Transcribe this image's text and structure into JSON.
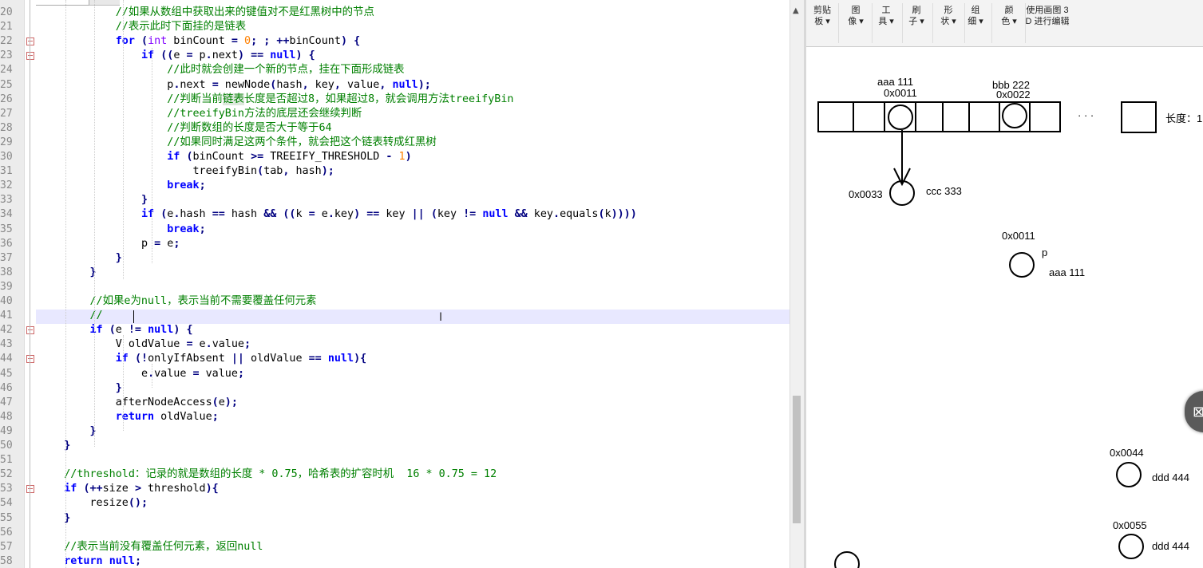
{
  "editor": {
    "lines": [
      {
        "n": "20",
        "html": "            <span class='cm'>//如果从数组中获取出来的键值对不是红黑树中的节点</span>"
      },
      {
        "n": "21",
        "html": "            <span class='cm'>//表示此时下面挂的是链表</span>"
      },
      {
        "n": "22",
        "html": "            <span class='kw'>for</span> <span class='op'>(</span><span class='typ'>int</span> binCount <span class='op'>=</span> <span class='num'>0</span><span class='op'>;</span> <span class='op'>;</span> <span class='op'>++</span>binCount<span class='op'>)</span> <span class='op'>{</span>"
      },
      {
        "n": "23",
        "html": "                <span class='kw'>if</span> <span class='op'>((</span>e <span class='op'>=</span> p<span class='op'>.</span>next<span class='op'>)</span> <span class='op'>==</span> <span class='kw'>null</span><span class='op'>)</span> <span class='op'>{</span>"
      },
      {
        "n": "24",
        "html": "                    <span class='cm'>//此时就会创建一个新的节点，挂在下面形成链表</span>"
      },
      {
        "n": "25",
        "html": "                    p<span class='op'>.</span>next <span class='op'>=</span> newNode<span class='op'>(</span>hash<span class='op'>,</span> key<span class='op'>,</span> value<span class='op'>,</span> <span class='kw'>null</span><span class='op'>);</span>"
      },
      {
        "n": "26",
        "html": "                    <span class='cm'>//判断当前<span style='background:#dde8dd'>链表</span>长度是否超过8，如果超过8，就会调用方法treeifyBin</span>"
      },
      {
        "n": "27",
        "html": "                    <span class='cm'>//treeifyBin方法的底层还会继续判断</span>"
      },
      {
        "n": "28",
        "html": "                    <span class='cm'>//判断数组的长度是否大于等于64</span>"
      },
      {
        "n": "29",
        "html": "                    <span class='cm'>//如果同时满足这两个条件，就会把这个链表转成红黑树</span>"
      },
      {
        "n": "30",
        "html": "                    <span class='kw'>if</span> <span class='op'>(</span>binCount <span class='op'>&gt;=</span> TREEIFY_THRESHOLD <span class='op'>-</span> <span class='num'>1</span><span class='op'>)</span>"
      },
      {
        "n": "31",
        "html": "                        treeifyBin<span class='op'>(</span>tab<span class='op'>,</span> hash<span class='op'>);</span>"
      },
      {
        "n": "32",
        "html": "                    <span class='kw'>break</span><span class='op'>;</span>"
      },
      {
        "n": "33",
        "html": "                <span class='op'>}</span>"
      },
      {
        "n": "34",
        "html": "                <span class='kw'>if</span> <span class='op'>(</span>e<span class='op'>.</span>hash <span class='op'>==</span> hash <span class='op'>&amp;&amp;</span> <span class='op'>((</span>k <span class='op'>=</span> e<span class='op'>.</span>key<span class='op'>)</span> <span class='op'>==</span> key <span class='op'>||</span> <span class='op'>(</span>key <span class='op'>!=</span> <span class='kw'>null</span> <span class='op'>&amp;&amp;</span> key<span class='op'>.</span>equals<span class='op'>(</span>k<span class='op'>))))</span>"
      },
      {
        "n": "35",
        "html": "                    <span class='kw'>break</span><span class='op'>;</span>"
      },
      {
        "n": "36",
        "html": "                p <span class='op'>=</span> e<span class='op'>;</span>"
      },
      {
        "n": "37",
        "html": "            <span class='op'>}</span>"
      },
      {
        "n": "38",
        "html": "        <span class='op'>}</span>"
      },
      {
        "n": "39",
        "html": ""
      },
      {
        "n": "40",
        "html": "        <span class='cm'>//如果e为null，表示当前不需要覆盖任何元素</span>"
      },
      {
        "n": "41",
        "html": "        <span class='cm'>//</span>"
      },
      {
        "n": "42",
        "html": "        <span class='kw'>if</span> <span class='op'>(</span>e <span class='op'>!=</span> <span class='kw'>null</span><span class='op'>)</span> <span class='op'>{</span>"
      },
      {
        "n": "43",
        "html": "            V oldValue <span class='op'>=</span> e<span class='op'>.</span>value<span class='op'>;</span>"
      },
      {
        "n": "44",
        "html": "            <span class='kw'>if</span> <span class='op'>(!</span>onlyIfAbsent <span class='op'>||</span> oldValue <span class='op'>==</span> <span class='kw'>null</span><span class='op'>){</span>"
      },
      {
        "n": "45",
        "html": "                e<span class='op'>.</span>value <span class='op'>=</span> value<span class='op'>;</span>"
      },
      {
        "n": "46",
        "html": "            <span class='op'>}</span>"
      },
      {
        "n": "47",
        "html": "            afterNodeAccess<span class='op'>(</span>e<span class='op'>);</span>"
      },
      {
        "n": "48",
        "html": "            <span class='kw'>return</span> oldValue<span class='op'>;</span>"
      },
      {
        "n": "49",
        "html": "        <span class='op'>}</span>"
      },
      {
        "n": "50",
        "html": "    <span class='op'>}</span>"
      },
      {
        "n": "51",
        "html": ""
      },
      {
        "n": "52",
        "html": "    <span class='cm'>//threshold：记录的就是数组的长度 * 0.75，哈希表的扩容时机  16 * 0.75 = 12</span>"
      },
      {
        "n": "53",
        "html": "    <span class='kw'>if</span> <span class='op'>(++</span>size <span class='op'>&gt;</span> threshold<span class='op'>){</span>"
      },
      {
        "n": "54",
        "html": "        resize<span class='op'>();</span>"
      },
      {
        "n": "55",
        "html": "    <span class='op'>}</span>"
      },
      {
        "n": "56",
        "html": ""
      },
      {
        "n": "57",
        "html": "    <span class='cm'>//表示当前没有覆盖任何元素，返回null</span>"
      },
      {
        "n": "58",
        "html": "    <span class='kw'>return</span> <span class='kw'>null</span><span class='op'>;</span>"
      }
    ],
    "fold_lines": [
      "22",
      "23",
      "42",
      "44",
      "53"
    ]
  },
  "ribbon": {
    "items": [
      {
        "l1": "剪贴",
        "l2": "板 ▾"
      },
      {
        "l1": "图",
        "l2": "像 ▾"
      },
      {
        "l1": "工",
        "l2": "具 ▾"
      },
      {
        "l1": "刷",
        "l2": "子 ▾"
      },
      {
        "l1": "形",
        "l2": "状 ▾"
      },
      {
        "l1": "组",
        "l2": "细 ▾"
      },
      {
        "l1": "颜",
        "l2": "色 ▾"
      },
      {
        "l1": "使用画图 3",
        "l2": "D 进行编辑"
      }
    ]
  },
  "diagram": {
    "aaa_label": "aaa  111",
    "aaa_addr": "0x0011",
    "bbb_label": "bbb 222",
    "bbb_addr": "0x0022",
    "dots": "· · ·",
    "length_label": "长度：1",
    "ccc_addr": "0x0033",
    "ccc_label": "ccc 333",
    "p_addr": "0x0011",
    "p_name": "p",
    "p_label": "aaa  111",
    "d1_addr": "0x0044",
    "d1_label": "ddd 444",
    "d2_addr": "0x0055",
    "d2_label": "ddd 444"
  }
}
